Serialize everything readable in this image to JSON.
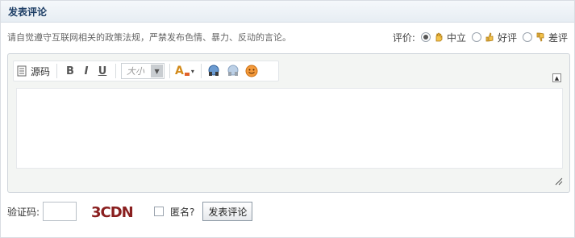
{
  "header": {
    "title": "发表评论"
  },
  "notice": "请自觉遵守互联网相关的政策法规，严禁发布色情、暴力、反动的言论。",
  "rating": {
    "label": "评价:",
    "options": [
      {
        "label": "中立",
        "checked": true,
        "icon": "hand-icon"
      },
      {
        "label": "好评",
        "checked": false,
        "icon": "thumbs-up-icon"
      },
      {
        "label": "差评",
        "checked": false,
        "icon": "thumbs-down-icon"
      }
    ]
  },
  "toolbar": {
    "source_label": "源码",
    "bold_label": "B",
    "italic_label": "I",
    "underline_label": "U",
    "size_placeholder": "大小",
    "font_color_label": "A"
  },
  "captcha": {
    "label": "验证码:",
    "value": "",
    "image_text": "3CDN"
  },
  "anonymous": {
    "label": "匿名?",
    "checked": false
  },
  "submit_label": "发表评论",
  "colors": {
    "header_title": "#1f3f66",
    "header_bg": "#e7edf3",
    "editor_bg": "#f3f5f3"
  }
}
